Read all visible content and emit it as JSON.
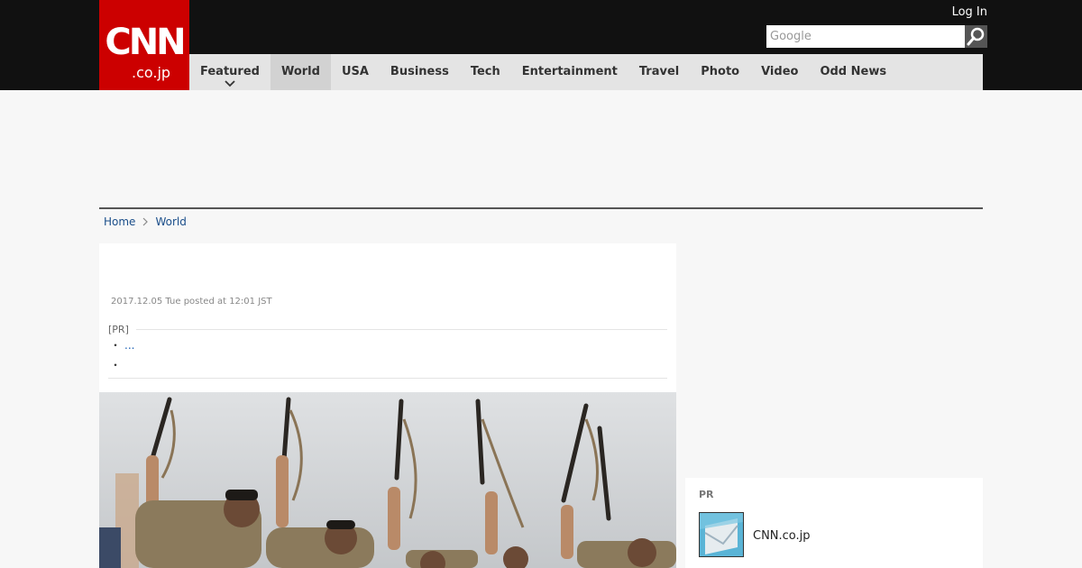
{
  "header": {
    "logo_text": "CNN",
    "logo_sub": ".co.jp",
    "login_label": "Log In",
    "search": {
      "placeholder": "Google"
    }
  },
  "nav": {
    "items": [
      {
        "label": "Featured",
        "active": true,
        "has_dropdown": true
      },
      {
        "label": "World",
        "active": true
      },
      {
        "label": "USA"
      },
      {
        "label": "Business"
      },
      {
        "label": "Tech"
      },
      {
        "label": "Entertainment"
      },
      {
        "label": "Travel"
      },
      {
        "label": "Photo"
      },
      {
        "label": "Video"
      },
      {
        "label": "Odd News"
      }
    ]
  },
  "breadcrumb": [
    "Home",
    "World"
  ],
  "article": {
    "posted": "2017.12.05 Tue posted at 12:01 JST",
    "pr_label": "[PR]",
    "bullet_1_link": "...",
    "bullet_mark": "・"
  },
  "sidebar": {
    "pr_title": "PR",
    "pr_item": "CNN.co.jp"
  },
  "colors": {
    "brand_red": "#cc0000",
    "topbar": "#111111",
    "nav_bg": "#e4e4e4",
    "link": "#1a4e8a"
  },
  "icons": {
    "search": "magnifier-icon",
    "breadcrumb_sep": "chevron-right-icon",
    "featured_dropdown": "chevron-down-icon"
  }
}
